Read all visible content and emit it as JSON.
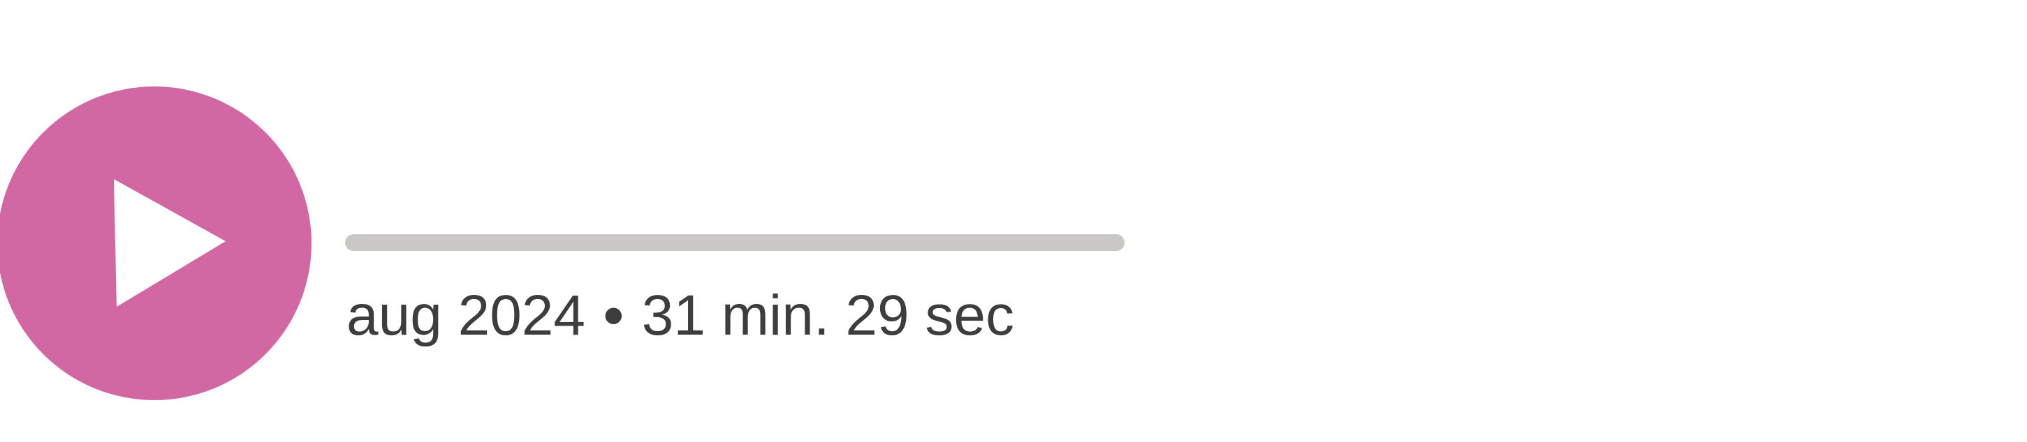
{
  "player": {
    "accent_color": "#d268a3",
    "play_icon": "play-icon",
    "progress": 0,
    "date": "aug 2024",
    "separator": "•",
    "duration": "31 min. 29 sec"
  }
}
